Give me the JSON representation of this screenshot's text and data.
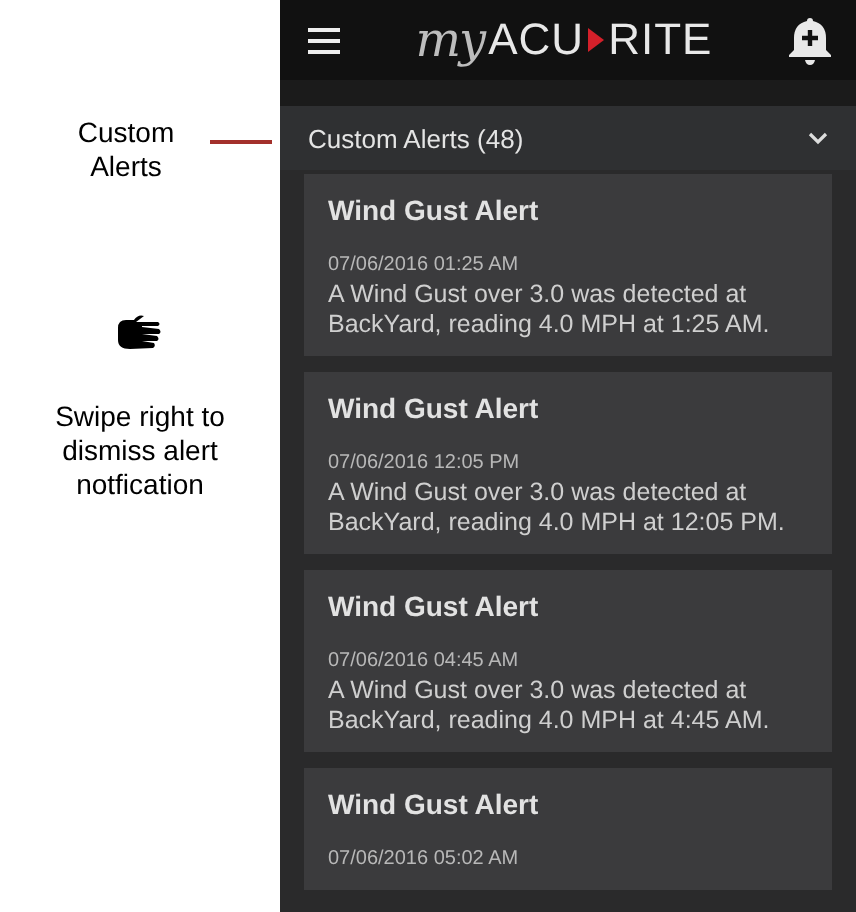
{
  "annotations": {
    "callout": "Custom Alerts",
    "gesture_caption": "Swipe right to dismiss alert notfication"
  },
  "header": {
    "logo": {
      "script": "my",
      "left": "ACU",
      "right": "RITE"
    }
  },
  "section": {
    "title": "Custom Alerts (48)",
    "expanded": true
  },
  "alerts": [
    {
      "title": "Wind Gust Alert",
      "time": "07/06/2016 01:25 AM",
      "message": "A Wind Gust over 3.0 was detected at BackYard, reading 4.0 MPH at 1:25 AM."
    },
    {
      "title": "Wind Gust Alert",
      "time": "07/06/2016 12:05 PM",
      "message": "A Wind Gust over 3.0 was detected at BackYard, reading 4.0 MPH at 12:05 PM."
    },
    {
      "title": "Wind Gust Alert",
      "time": "07/06/2016 04:45 AM",
      "message": "A Wind Gust over 3.0 was detected at BackYard, reading 4.0 MPH at 4:45 AM."
    },
    {
      "title": "Wind Gust Alert",
      "time": "07/06/2016 05:02 AM"
    }
  ]
}
